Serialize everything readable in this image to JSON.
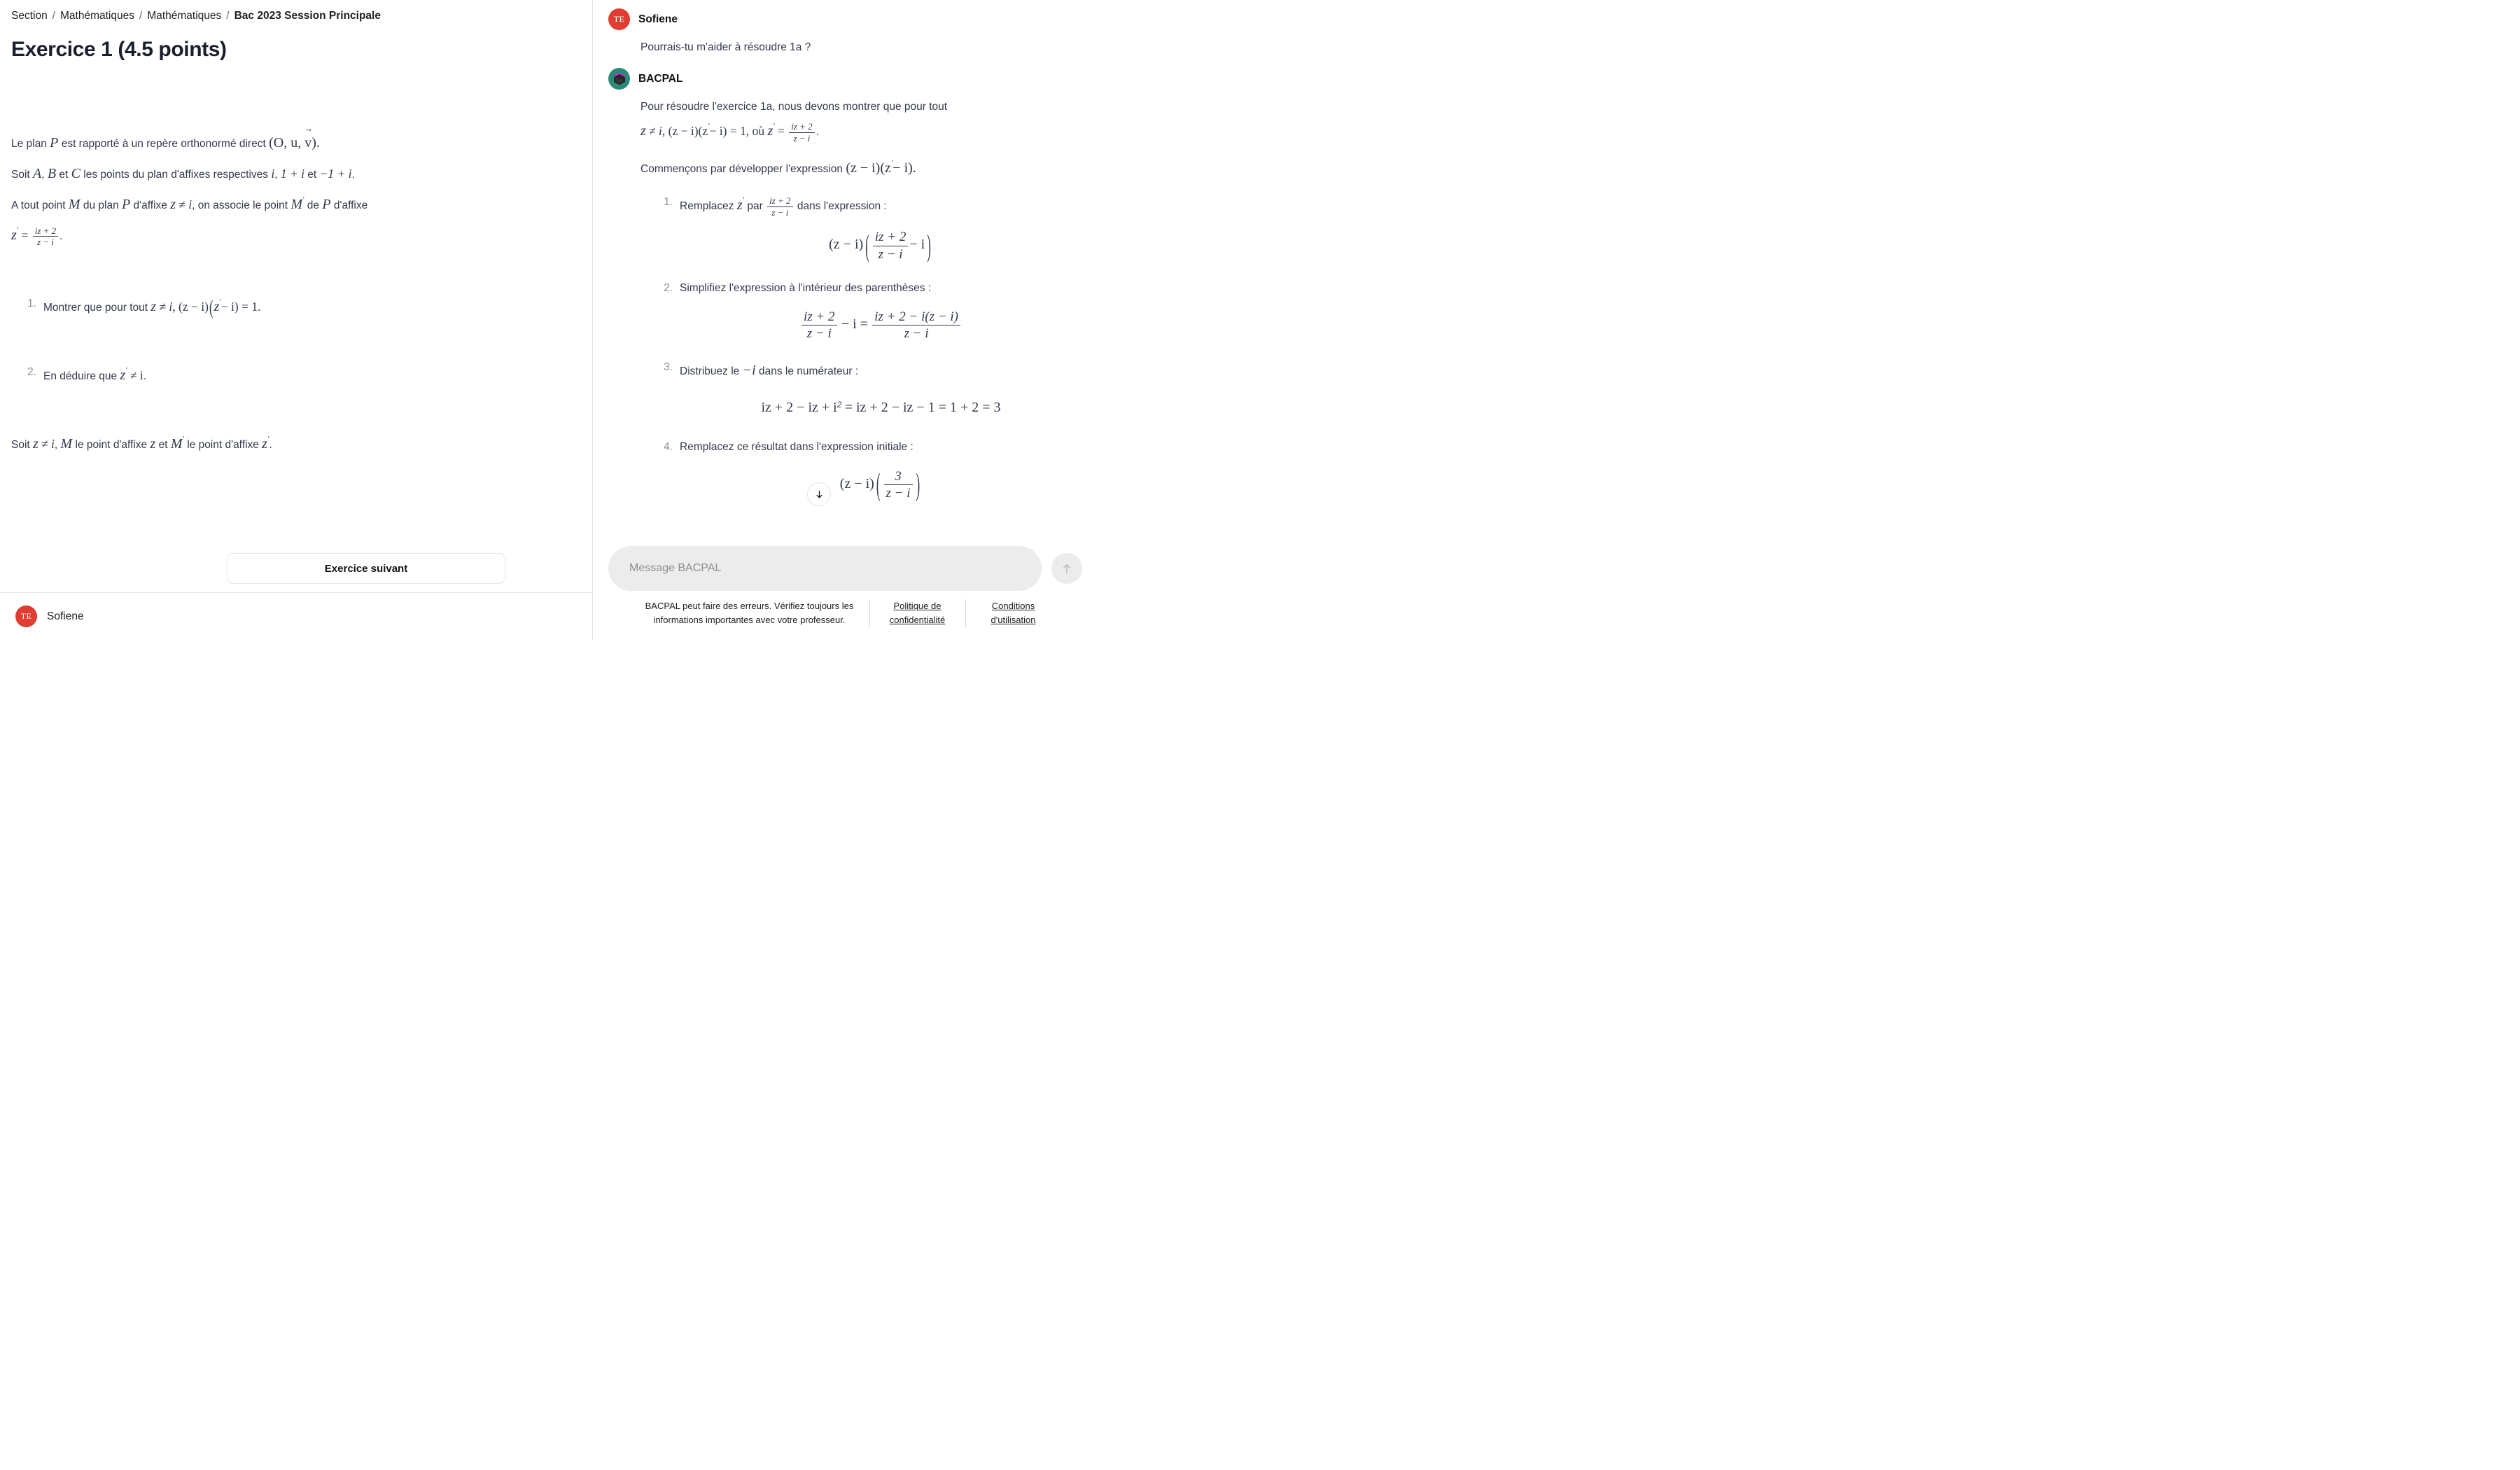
{
  "breadcrumb": {
    "items": [
      "Section",
      "Mathématiques",
      "Mathématiques",
      "Bac 2023 Session Principale"
    ],
    "separator": "/"
  },
  "exercise": {
    "title": "Exercice 1 (4.5 points)",
    "statement_line1_a": "Le plan ",
    "statement_line1_P": "P",
    "statement_line1_b": " est rapporté à un repère orthonormé direct ",
    "statement_line1_frame_open": "(O, u, ",
    "statement_line1_frame_v": "v",
    "statement_line1_frame_close": ").",
    "statement_line2_a": "Soit ",
    "statement_line2_A": "A",
    "statement_line2_B": "B",
    "statement_line2_C": "C",
    "statement_line2_et": " et ",
    "statement_line2_b": " les points du plan d'affixes respectives ",
    "statement_line2_i": "i",
    "statement_line2_one_plus_i": "1 + i",
    "statement_line2_minus_one_plus_i": "−1 + i",
    "statement_line3_a": "A tout point ",
    "statement_line3_M": "M",
    "statement_line3_b": " du plan ",
    "statement_line3_P": "P",
    "statement_line3_c": " d'affixe ",
    "statement_line3_z": "z",
    "statement_line3_neq": "≠",
    "statement_line3_i": "i",
    "statement_line3_d": ", on associe le point ",
    "statement_line3_Mprime": "M",
    "statement_line3_e": " de ",
    "statement_line3_P2": "P",
    "statement_line3_f": " d'affixe",
    "formula_z_prime": "z",
    "formula_equals": "=",
    "formula_num": "iz + 2",
    "formula_den": "z − i",
    "questions": [
      {
        "number": "1.",
        "text_before": "Montrer que pour tout ",
        "z": "z",
        "neq": "≠",
        "i": "i",
        "mid": ", (z − i)",
        "expr_zprime": "z",
        "expr_tail": "− i) = 1."
      },
      {
        "number": "2.",
        "text_before": "En déduire que ",
        "z": "z",
        "neq": "≠",
        "i": "i",
        "period": "."
      }
    ],
    "tail_a": "Soit ",
    "tail_z": "z",
    "tail_neq": "≠",
    "tail_i": "i",
    "tail_b": ", ",
    "tail_M": "M",
    "tail_c": " le point d'affixe ",
    "tail_z2": "z",
    "tail_d": " et ",
    "tail_Mprime": "M",
    "tail_e": " le point d'affixe ",
    "tail_zprime": "z",
    "tail_f": ".",
    "next_button": "Exercice suivant"
  },
  "left_footer": {
    "avatar_initials": "TE",
    "avatar_color": "#e03c31",
    "user_name": "Sofiene"
  },
  "chat": {
    "messages": [
      {
        "role": "user",
        "avatar_initials": "TE",
        "avatar_color": "#e03c31",
        "author": "Sofiene",
        "text": "Pourrais-tu m'aider à résoudre 1a ?"
      },
      {
        "role": "assistant",
        "avatar_color": "#2a8a77",
        "avatar_accent": "#e619e6",
        "author": "BACPAL",
        "intro_a": "Pour résoudre l'exercice 1a, nous devons montrer que pour tout",
        "intro_z": "z",
        "intro_neq": "≠",
        "intro_i": "i",
        "intro_b": ", (z − i)(z",
        "intro_c": "− i) = 1, où ",
        "intro_zprime": "z",
        "intro_eq": "=",
        "intro_frac_num": "iz + 2",
        "intro_frac_den": "z − i",
        "intro_period": ".",
        "develop_a": "Commençons par développer l'expression ",
        "develop_expr_1": "(z − i)(z",
        "develop_expr_2": "− i).",
        "steps": [
          {
            "number": "1.",
            "text_a": "Remplacez ",
            "z": "z",
            "text_b": " par ",
            "frac_num": "iz + 2",
            "frac_den": "z − i",
            "text_c": " dans l'expression :",
            "equation_left": "(z − i)",
            "equation_frac_num": "iz + 2",
            "equation_frac_den": "z − i",
            "equation_tail": "− i"
          },
          {
            "number": "2.",
            "text": "Simplifiez l'expression à l'intérieur des parenthèses :",
            "eq_f1_num": "iz + 2",
            "eq_f1_den": "z − i",
            "eq_minus_i": "− i =",
            "eq_f2_num": "iz + 2 − i(z − i)",
            "eq_f2_den": "z − i"
          },
          {
            "number": "3.",
            "text_a": "Distribuez le ",
            "minus_i": "−i",
            "text_b": " dans le numérateur :",
            "equation": "iz + 2 − iz + i",
            "equation_sup": "2",
            "equation_rest": "= iz + 2 − iz − 1 = 1 + 2 = 3"
          },
          {
            "number": "4.",
            "text": "Remplacez ce résultat dans l'expression initiale :",
            "equation_left": "(z − i)",
            "equation_frac_num": "3",
            "equation_frac_den": "z − i"
          }
        ]
      }
    ],
    "scroll_down_icon": "arrow-down"
  },
  "composer": {
    "placeholder": "Message BACPAL",
    "value": "",
    "send_icon": "arrow-up"
  },
  "footer": {
    "disclaimer": "BACPAL peut faire des erreurs. Vérifiez toujours les informations importantes avec votre professeur.",
    "link_privacy": "Politique de confidentialité",
    "link_terms": "Conditions d'utilisation"
  }
}
